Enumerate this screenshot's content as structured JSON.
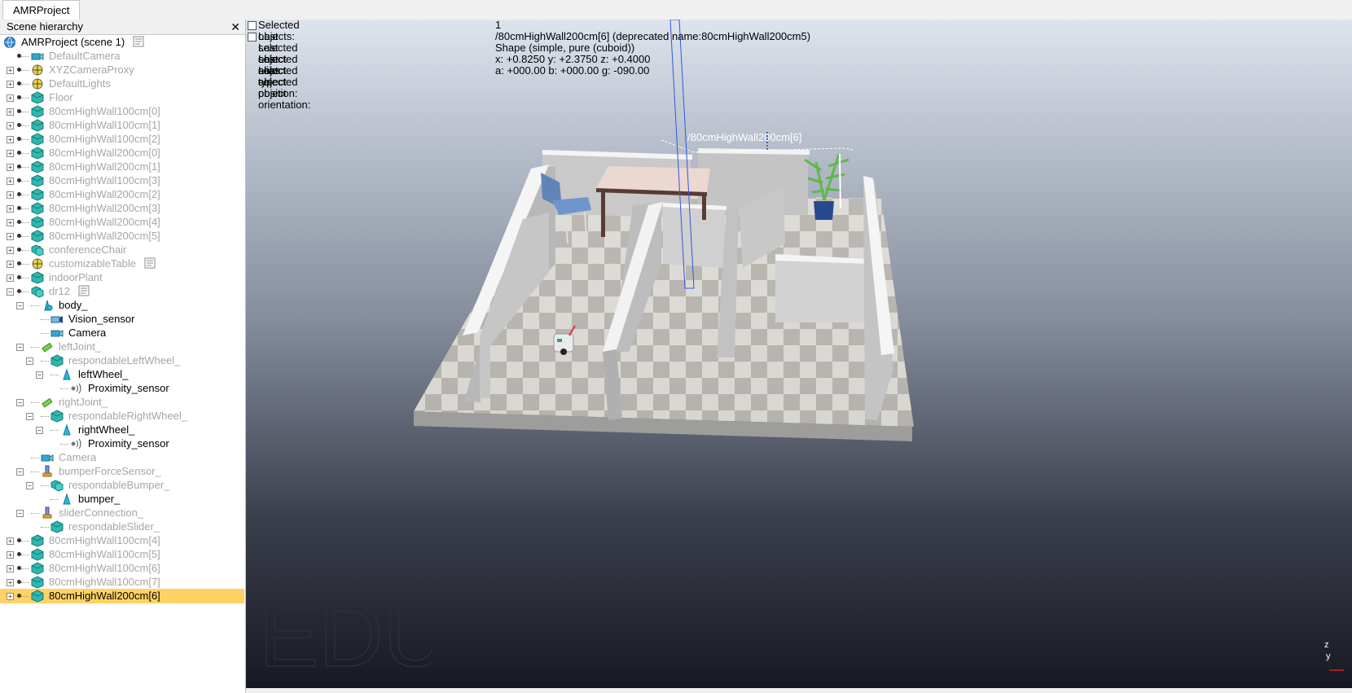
{
  "tab": {
    "label": "AMRProject"
  },
  "panel": {
    "title": "Scene hierarchy",
    "close_glyph": "✕"
  },
  "tree": [
    {
      "label": "AMRProject (scene 1)",
      "icon": "globe-icon",
      "level": 0,
      "dim": false,
      "script": true
    },
    {
      "label": "DefaultCamera",
      "icon": "camera-icon",
      "level": 1,
      "dim": true
    },
    {
      "label": "XYZCameraProxy",
      "icon": "dummy-icon",
      "level": 1,
      "dim": true,
      "expand": true
    },
    {
      "label": "DefaultLights",
      "icon": "dummy-icon",
      "level": 1,
      "dim": true,
      "expand": true
    },
    {
      "label": "Floor",
      "icon": "shape-icon",
      "level": 1,
      "dim": true,
      "expand": true
    },
    {
      "label": "80cmHighWall100cm[0]",
      "icon": "shape-icon",
      "level": 1,
      "dim": true,
      "expand": true
    },
    {
      "label": "80cmHighWall100cm[1]",
      "icon": "shape-icon",
      "level": 1,
      "dim": true,
      "expand": true
    },
    {
      "label": "80cmHighWall100cm[2]",
      "icon": "shape-icon",
      "level": 1,
      "dim": true,
      "expand": true
    },
    {
      "label": "80cmHighWall200cm[0]",
      "icon": "shape-icon",
      "level": 1,
      "dim": true,
      "expand": true
    },
    {
      "label": "80cmHighWall200cm[1]",
      "icon": "shape-icon",
      "level": 1,
      "dim": true,
      "expand": true
    },
    {
      "label": "80cmHighWall100cm[3]",
      "icon": "shape-icon",
      "level": 1,
      "dim": true,
      "expand": true
    },
    {
      "label": "80cmHighWall200cm[2]",
      "icon": "shape-icon",
      "level": 1,
      "dim": true,
      "expand": true
    },
    {
      "label": "80cmHighWall200cm[3]",
      "icon": "shape-icon",
      "level": 1,
      "dim": true,
      "expand": true
    },
    {
      "label": "80cmHighWall200cm[4]",
      "icon": "shape-icon",
      "level": 1,
      "dim": true,
      "expand": true
    },
    {
      "label": "80cmHighWall200cm[5]",
      "icon": "shape-icon",
      "level": 1,
      "dim": true,
      "expand": true
    },
    {
      "label": "conferenceChair",
      "icon": "compound-shape-icon",
      "level": 1,
      "dim": true,
      "expand": true
    },
    {
      "label": "customizableTable",
      "icon": "dummy-icon",
      "level": 1,
      "dim": true,
      "expand": true,
      "script": true
    },
    {
      "label": "indoorPlant",
      "icon": "shape-icon",
      "level": 1,
      "dim": true,
      "expand": true
    },
    {
      "label": "dr12",
      "icon": "compound-shape-icon",
      "level": 1,
      "dim": true,
      "expand": true,
      "open": true,
      "script": true
    },
    {
      "label": "body_",
      "icon": "body-shape-icon",
      "level": 2,
      "dim": false,
      "expand": true,
      "open": true
    },
    {
      "label": "Vision_sensor",
      "icon": "vision-sensor-icon",
      "level": 3,
      "dim": false
    },
    {
      "label": "Camera",
      "icon": "camera-icon",
      "level": 3,
      "dim": false
    },
    {
      "label": "leftJoint_",
      "icon": "joint-icon",
      "level": 2,
      "dim": true,
      "expand": true,
      "open": true
    },
    {
      "label": "respondableLeftWheel_",
      "icon": "shape-icon",
      "level": 3,
      "dim": true,
      "expand": true,
      "open": true
    },
    {
      "label": "leftWheel_",
      "icon": "wheel-shape-icon",
      "level": 4,
      "dim": false,
      "expand": true,
      "open": true
    },
    {
      "label": "Proximity_sensor",
      "icon": "proximity-sensor-icon",
      "level": 5,
      "dim": false
    },
    {
      "label": "rightJoint_",
      "icon": "joint-icon",
      "level": 2,
      "dim": true,
      "expand": true,
      "open": true
    },
    {
      "label": "respondableRightWheel_",
      "icon": "shape-icon",
      "level": 3,
      "dim": true,
      "expand": true,
      "open": true
    },
    {
      "label": "rightWheel_",
      "icon": "wheel-shape-icon",
      "level": 4,
      "dim": false,
      "expand": true,
      "open": true
    },
    {
      "label": "Proximity_sensor",
      "icon": "proximity-sensor-icon",
      "level": 5,
      "dim": false
    },
    {
      "label": "Camera",
      "icon": "camera-icon",
      "level": 2,
      "dim": true
    },
    {
      "label": "bumperForceSensor_",
      "icon": "force-sensor-icon",
      "level": 2,
      "dim": true,
      "expand": true,
      "open": true
    },
    {
      "label": "respondableBumper_",
      "icon": "compound-shape-icon",
      "level": 3,
      "dim": true,
      "expand": true,
      "open": true
    },
    {
      "label": "bumper_",
      "icon": "wheel-shape-icon",
      "level": 4,
      "dim": false
    },
    {
      "label": "sliderConnection_",
      "icon": "force-sensor-icon",
      "level": 2,
      "dim": true,
      "expand": true,
      "open": true
    },
    {
      "label": "respondableSlider_",
      "icon": "shape-icon",
      "level": 3,
      "dim": true
    },
    {
      "label": "80cmHighWall100cm[4]",
      "icon": "shape-icon",
      "level": 1,
      "dim": true,
      "expand": true
    },
    {
      "label": "80cmHighWall100cm[5]",
      "icon": "shape-icon",
      "level": 1,
      "dim": true,
      "expand": true
    },
    {
      "label": "80cmHighWall100cm[6]",
      "icon": "shape-icon",
      "level": 1,
      "dim": true,
      "expand": true
    },
    {
      "label": "80cmHighWall100cm[7]",
      "icon": "shape-icon",
      "level": 1,
      "dim": true,
      "expand": true
    },
    {
      "label": "80cmHighWall200cm[6]",
      "icon": "shape-icon",
      "level": 1,
      "dim": false,
      "expand": true,
      "selected": true
    }
  ],
  "info": [
    {
      "key": "Selected objects:",
      "value": "1"
    },
    {
      "key": "Last selected object alias:",
      "value": "/80cmHighWall200cm[6]    (deprecated name:80cmHighWall200cm5)"
    },
    {
      "key": "Last selected object type:",
      "value": "Shape (simple, pure (cuboid))"
    },
    {
      "key": "Last selected object position:",
      "value": "x: +0.8250    y: +2.3750    z: +0.4000"
    },
    {
      "key": "Last selected object orientation:",
      "value": "a: +000.00    b: +000.00    g: -090.00"
    }
  ],
  "viewport": {
    "object_label": "/80cmHighWall200cm[6]",
    "watermark": "EDU",
    "axis_z": "z",
    "axis_y": "y"
  },
  "colors": {
    "selection": "#ffd264",
    "shape_icon": "#2fb8b0",
    "dim_text": "#a6a6a6"
  }
}
